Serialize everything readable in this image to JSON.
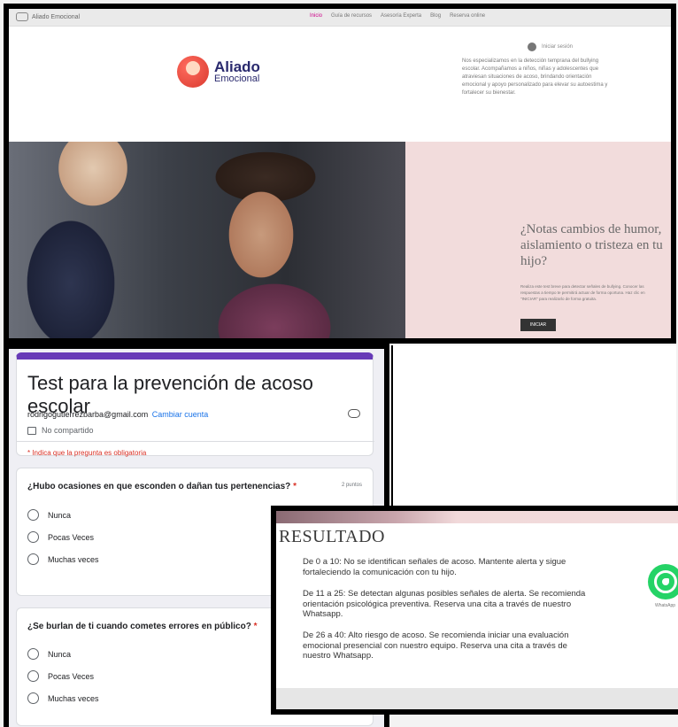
{
  "site": {
    "brand_small": "Aliado Emocional",
    "nav": [
      "Inicio",
      "Guía de recursos",
      "Asesoría Experta",
      "Blog",
      "Reserva online"
    ],
    "login_label": "Iniciar sesión",
    "logo_line1": "Aliado",
    "logo_line2": "Emocional",
    "tagline": "Nos especializamos en la detección temprana del bullying escolar. Acompañamos a niños, niñas y adolescentes que atraviesan situaciones de acoso, brindando orientación emocional y apoyo personalizado para elevar su autoestima y fortalecer su bienestar.",
    "hero_question": "¿Notas cambios de humor, aislamiento o tristeza en tu hijo?",
    "hero_text": "Realiza este test breve para detectar señales de bullying. Conocer las respuestas a tiempo te permitirá actuar de forma oportuna. Haz clic en \"INICIAR\" para realizarlo de forma gratuita.",
    "hero_button": "INICIAR"
  },
  "form": {
    "title": "Test para la prevención de acoso escolar",
    "account_email": "rodrigogutierrezbarba@gmail.com",
    "switch_account": "Cambiar cuenta",
    "not_shared": "No compartido",
    "required_note": "* Indica que la pregunta es obligatoria",
    "questions": [
      {
        "text": "¿Hubo ocasiones en que esconden o dañan tus pertenencias?",
        "required_mark": "*",
        "points": "2 puntos",
        "options": [
          "Nunca",
          "Pocas Veces",
          "Muchas veces"
        ]
      },
      {
        "text": "¿Se burlan de ti cuando cometes errores en público?",
        "required_mark": "*",
        "options": [
          "Nunca",
          "Pocas Veces",
          "Muchas veces"
        ]
      }
    ]
  },
  "result": {
    "title": "RESULTADO",
    "items": [
      "De 0 a 10: No se identifican señales de acoso. Mantente alerta y sigue fortaleciendo la comunicación con tu hijo.",
      "De 11 a 25: Se detectan algunas posibles señales de alerta. Se recomienda orientación psicológica preventiva. Reserva una cita a través de nuestro Whatsapp.",
      "De 26 a 40: Alto riesgo de acoso. Se recomienda iniciar una evaluación emocional presencial con nuestro equipo. Reserva una cita a través de nuestro Whatsapp."
    ],
    "whatsapp_label": "WhatsApp"
  },
  "colors": {
    "form_accent": "#673ab7",
    "required_red": "#d93025",
    "link_blue": "#1a73e8",
    "hero_pink": "#f2dcdc",
    "whatsapp_green": "#25d366"
  }
}
